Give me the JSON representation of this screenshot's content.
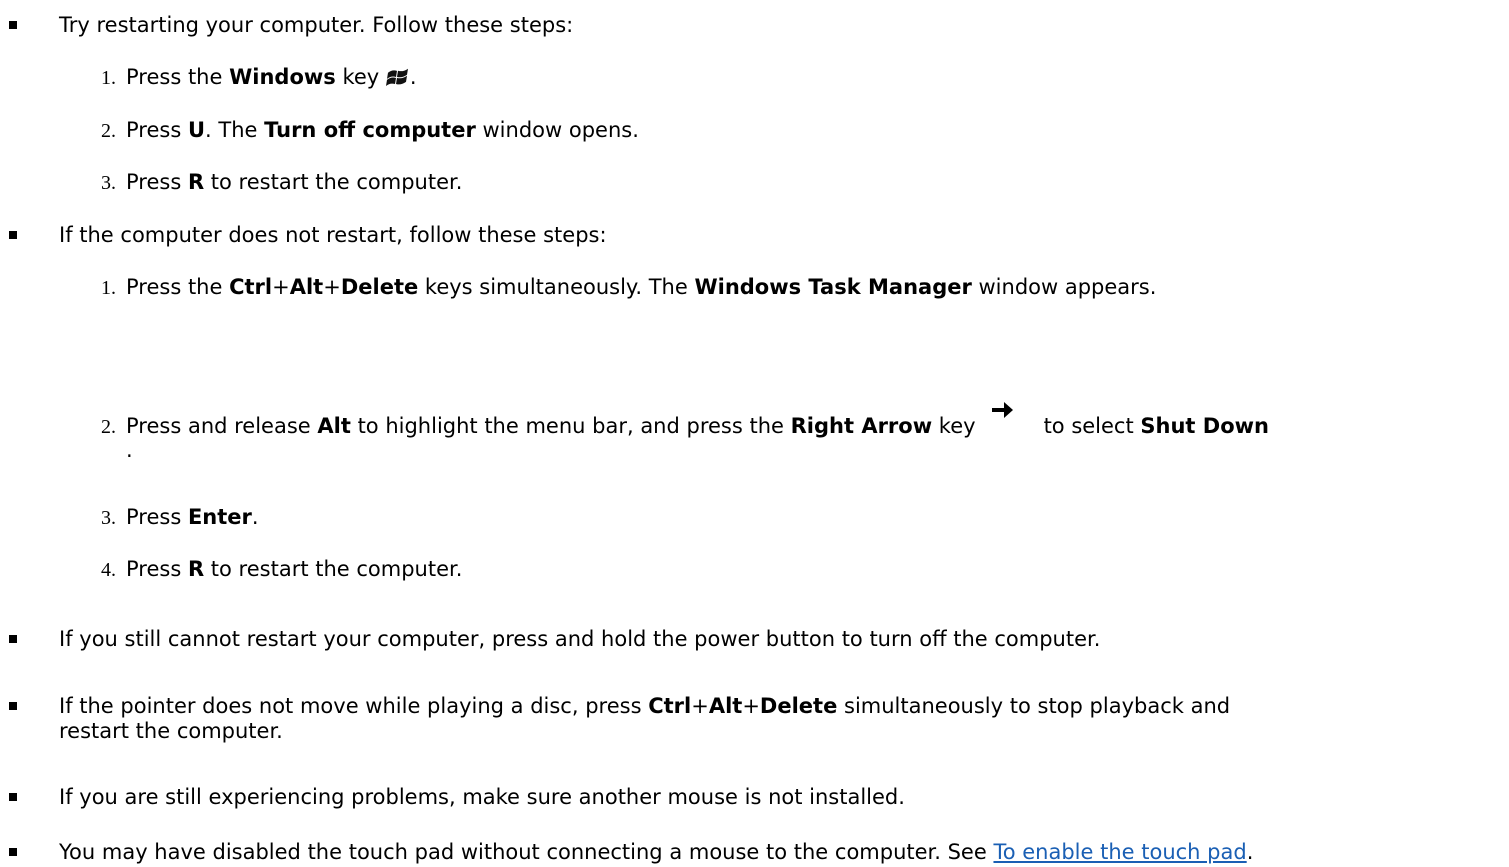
{
  "items": [
    {
      "lead": "Try restarting your computer. Follow these steps:",
      "steps": [
        {
          "num": "1.",
          "t1": "Press the ",
          "b1": "Windows",
          "t2": " key ",
          "icon": "windows-logo-icon",
          "t3": "."
        },
        {
          "num": "2.",
          "t1": "Press ",
          "b1": "U",
          "t2": ". The ",
          "b2": "Turn off computer",
          "t3": " window opens."
        },
        {
          "num": "3.",
          "t1": "Press ",
          "b1": "R",
          "t2": " to restart the computer."
        }
      ]
    },
    {
      "lead": "If the computer does not restart, follow these steps:",
      "steps": [
        {
          "num": "1.",
          "t1": "Press the ",
          "b1": "Ctrl",
          "p1": "+",
          "b2": "Alt",
          "p2": "+",
          "b3": "Delete",
          "t2": " keys simultaneously. The ",
          "b4": "Windows Task Manager",
          "t3": " window appears."
        },
        {
          "num": "2.",
          "t1": "Press and release ",
          "b1": "Alt",
          "t2": " to highlight the menu bar, and press the ",
          "b2": "Right Arrow",
          "t3": " key",
          "icon": "right-arrow-icon",
          "t4": "to select ",
          "b3": "Shut Down",
          "t5": "."
        },
        {
          "num": "3.",
          "t1": "Press ",
          "b1": "Enter",
          "t2": "."
        },
        {
          "num": "4.",
          "t1": "Press ",
          "b1": "R",
          "t2": " to restart the computer."
        }
      ]
    },
    {
      "text": "If you still cannot restart your computer, press and hold the power button to turn off the computer."
    },
    {
      "t1": "If the pointer does not move while playing a disc, press ",
      "b1": "Ctrl",
      "p1": "+",
      "b2": "Alt",
      "p2": "+",
      "b3": "Delete",
      "t2": " simultaneously to stop playback and",
      "t3": "restart the computer."
    },
    {
      "text": "If you are still experiencing problems, make sure another mouse is not installed."
    },
    {
      "t1": "You may have disabled the touch pad without connecting a mouse to the computer. See ",
      "link": "To enable the touch pad",
      "t2": "."
    }
  ]
}
